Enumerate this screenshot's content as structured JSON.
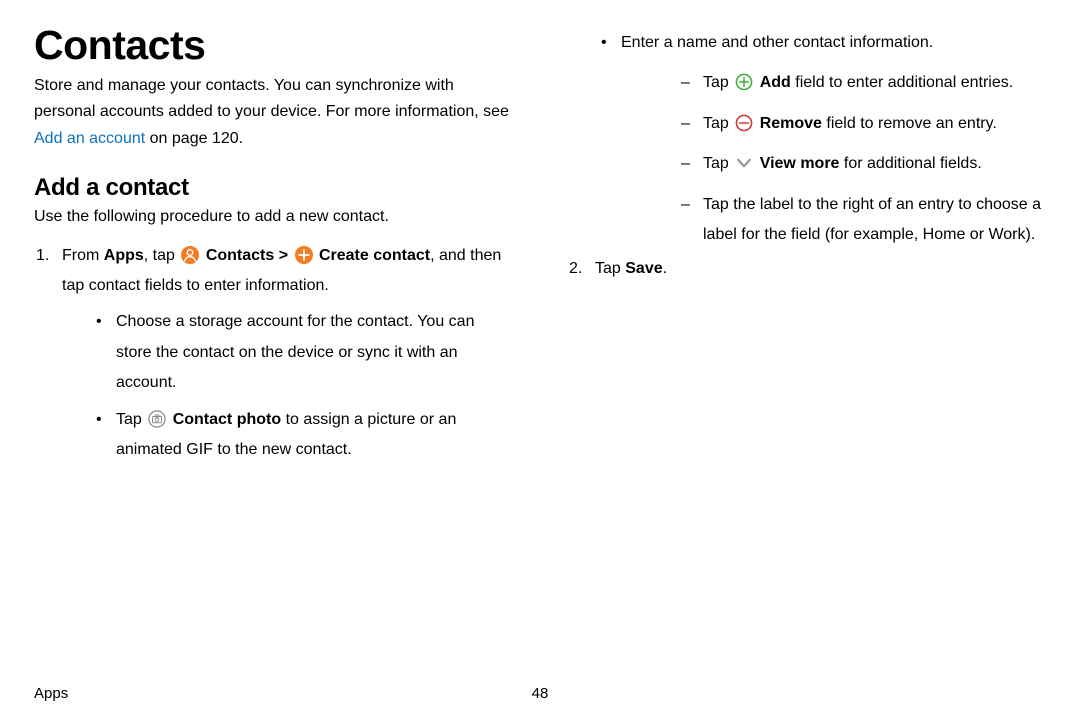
{
  "title": "Contacts",
  "intro_pre": "Store and manage your contacts. You can synchronize with personal accounts added to your device. For more information, see ",
  "intro_link": "Add an account",
  "intro_post": " on page 120.",
  "h2": "Add a contact",
  "h2_sub": "Use the following procedure to add a new contact.",
  "step1": {
    "pre": "From ",
    "apps": "Apps",
    "mid1": ", tap ",
    "contacts": "Contacts",
    "chev": " > ",
    "create": "Create contact",
    "post1": ", and then tap contact fields to enter information.",
    "b_storage": "Choose a storage account for the contact. You can store the contact on the device or sync it with an account.",
    "b_photo_pre": "Tap ",
    "b_photo_bold": "Contact photo",
    "b_photo_post": " to assign a picture or an animated GIF to the new contact."
  },
  "col2": {
    "enter": "Enter a name and other contact information.",
    "add_pre": "Tap ",
    "add_bold": "Add",
    "add_post": " field to enter additional entries.",
    "rem_pre": "Tap ",
    "rem_bold": "Remove",
    "rem_post": " field to remove an entry.",
    "vm_pre": "Tap ",
    "vm_bold": "View more",
    "vm_post": " for additional fields.",
    "label": "Tap the label to the right of an entry to choose a label for the field (for example, Home or Work)."
  },
  "step2_pre": "Tap ",
  "step2_bold": "Save",
  "step2_post": ".",
  "footer_left": "Apps",
  "footer_page": "48"
}
